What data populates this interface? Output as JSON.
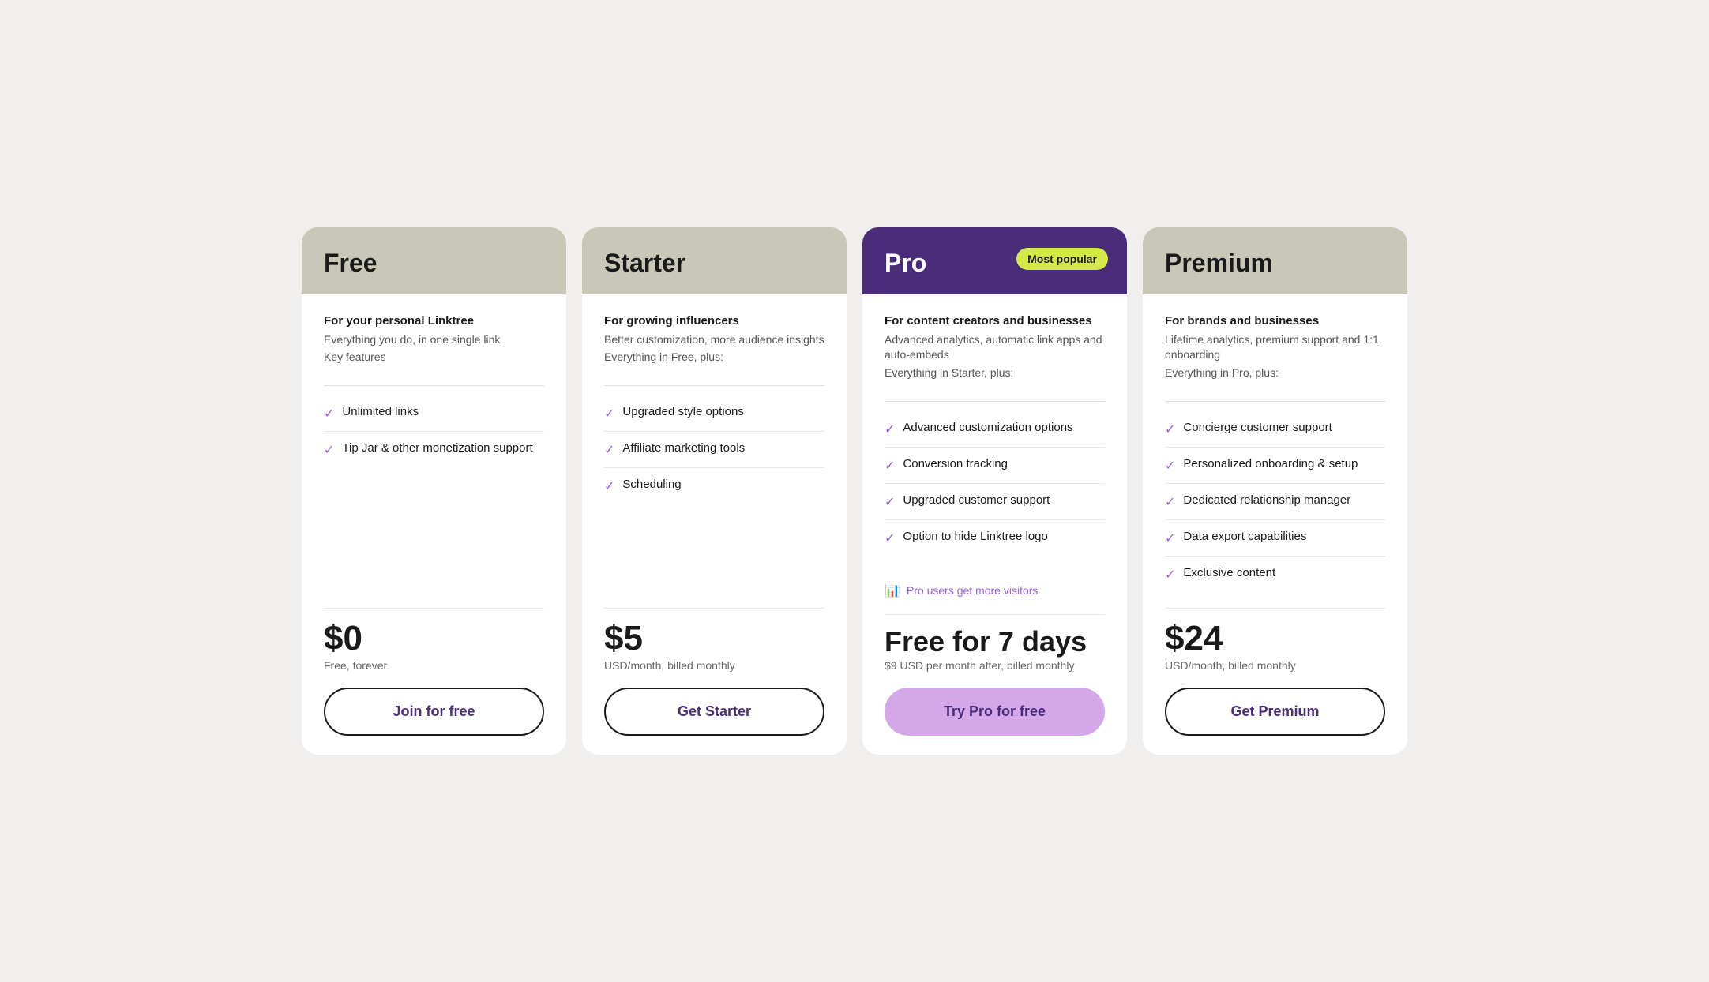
{
  "plans": [
    {
      "id": "free",
      "title": "Free",
      "headerClass": "plan-header",
      "titleClass": "plan-title",
      "description": "For your personal Linktree",
      "subtitle": "Everything you do, in one single link",
      "featuresIntro": "Key features",
      "features": [
        "Unlimited links",
        "Tip Jar & other monetization support"
      ],
      "price": "$0",
      "priceSub": "Free, forever",
      "ctaLabel": "Join for free",
      "ctaClass": "cta-button",
      "mostPopular": false,
      "proVisitors": null
    },
    {
      "id": "starter",
      "title": "Starter",
      "headerClass": "plan-header",
      "titleClass": "plan-title",
      "description": "For growing influencers",
      "subtitle": "Better customization, more audience insights",
      "featuresIntro": "Everything in Free, plus:",
      "features": [
        "Upgraded style options",
        "Affiliate marketing tools",
        "Scheduling"
      ],
      "price": "$5",
      "priceSub": "USD/month, billed monthly",
      "ctaLabel": "Get Starter",
      "ctaClass": "cta-button",
      "mostPopular": false,
      "proVisitors": null
    },
    {
      "id": "pro",
      "title": "Pro",
      "headerClass": "plan-header pro-header",
      "titleClass": "plan-title pro-title",
      "description": "For content creators and businesses",
      "subtitle": "Advanced analytics, automatic link apps and auto-embeds",
      "featuresIntro": "Everything in Starter, plus:",
      "features": [
        "Advanced customization options",
        "Conversion tracking",
        "Upgraded customer support",
        "Option to hide Linktree logo"
      ],
      "price": "Free for 7 days",
      "priceSub": "$9 USD per month after, billed monthly",
      "ctaLabel": "Try Pro for free",
      "ctaClass": "cta-button pro-btn",
      "mostPopular": true,
      "mostPopularLabel": "Most popular",
      "proVisitors": "Pro users get more visitors"
    },
    {
      "id": "premium",
      "title": "Premium",
      "headerClass": "plan-header",
      "titleClass": "plan-title",
      "description": "For brands and businesses",
      "subtitle": "Lifetime analytics, premium support and 1:1 onboarding",
      "featuresIntro": "Everything in Pro, plus:",
      "features": [
        "Concierge customer support",
        "Personalized onboarding & setup",
        "Dedicated relationship manager",
        "Data export capabilities",
        "Exclusive content"
      ],
      "price": "$24",
      "priceSub": "USD/month, billed monthly",
      "ctaLabel": "Get Premium",
      "ctaClass": "cta-button",
      "mostPopular": false,
      "proVisitors": null
    }
  ]
}
